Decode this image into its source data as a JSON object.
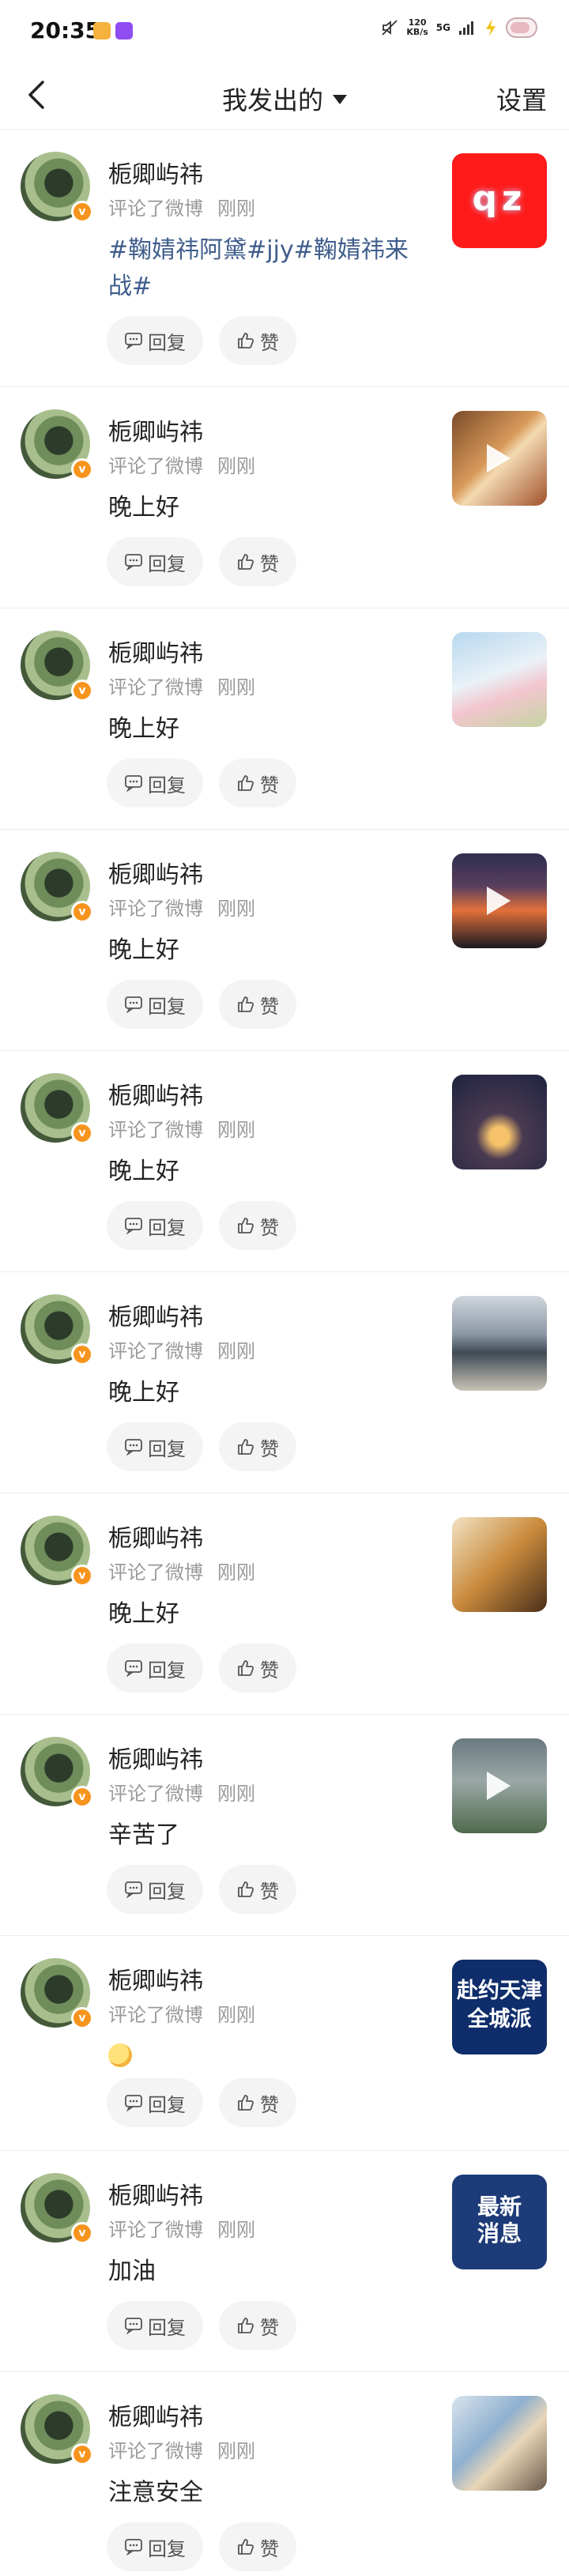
{
  "status_bar": {
    "time": "20:35",
    "speed_value": "120",
    "speed_unit": "KB/s",
    "network": "5G"
  },
  "nav": {
    "title": "我发出的",
    "settings_label": "设置"
  },
  "actions": {
    "reply_label": "回复",
    "like_label": "赞"
  },
  "items": [
    {
      "name": "栀卿屿祎",
      "action": "评论了微博",
      "time": "刚刚",
      "content": "#鞠婧祎阿黛#jjy#鞠婧祎来战#",
      "is_tag": true,
      "thumb_text": "qz"
    },
    {
      "name": "栀卿屿祎",
      "action": "评论了微博",
      "time": "刚刚",
      "content": "晚上好",
      "is_tag": false
    },
    {
      "name": "栀卿屿祎",
      "action": "评论了微博",
      "time": "刚刚",
      "content": "晚上好",
      "is_tag": false
    },
    {
      "name": "栀卿屿祎",
      "action": "评论了微博",
      "time": "刚刚",
      "content": "晚上好",
      "is_tag": false
    },
    {
      "name": "栀卿屿祎",
      "action": "评论了微博",
      "time": "刚刚",
      "content": "晚上好",
      "is_tag": false
    },
    {
      "name": "栀卿屿祎",
      "action": "评论了微博",
      "time": "刚刚",
      "content": "晚上好",
      "is_tag": false
    },
    {
      "name": "栀卿屿祎",
      "action": "评论了微博",
      "time": "刚刚",
      "content": "晚上好",
      "is_tag": false
    },
    {
      "name": "栀卿屿祎",
      "action": "评论了微博",
      "time": "刚刚",
      "content": "辛苦了",
      "is_tag": false
    },
    {
      "name": "栀卿屿祎",
      "action": "评论了微博",
      "time": "刚刚",
      "content": "",
      "is_tag": false,
      "emoji": "laughing-emoji",
      "thumb_text": "赴约天津 全城派"
    },
    {
      "name": "栀卿屿祎",
      "action": "评论了微博",
      "time": "刚刚",
      "content": "加油",
      "is_tag": false,
      "thumb_text": "最新 消息"
    },
    {
      "name": "栀卿屿祎",
      "action": "评论了微博",
      "time": "刚刚",
      "content": "注意安全",
      "is_tag": false
    }
  ],
  "colors": {
    "tag": "#3f5d8c",
    "meta": "#9a9a9a",
    "pill_bg": "#f4f4f4",
    "verified_badge": "#f7941d"
  }
}
